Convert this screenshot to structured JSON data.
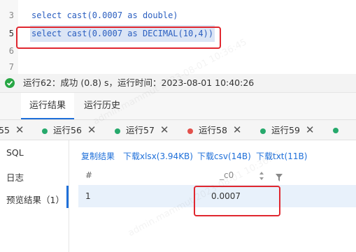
{
  "editor": {
    "lines": [
      {
        "num": "3",
        "code": "select cast(0.0007 as double)"
      },
      {
        "num": "5",
        "code": "select cast(0.0007 as DECIMAL(10,4))"
      },
      {
        "num": "6",
        "code": ""
      },
      {
        "num": "7",
        "code": ""
      }
    ]
  },
  "status": {
    "text": "运行62：成功 (0.8) s，运行时间：2023-08-01 10:40:26",
    "color": "#28a745"
  },
  "result_tabs": [
    "运行结果",
    "运行历史"
  ],
  "run_tabs": [
    {
      "label": "55",
      "status": "partial"
    },
    {
      "label": "运行56",
      "color": "#26a96c"
    },
    {
      "label": "运行57",
      "color": "#26a96c"
    },
    {
      "label": "运行58",
      "color": "#e2514c"
    },
    {
      "label": "运行59",
      "color": "#26a96c"
    },
    {
      "label": "",
      "color": "#26a96c"
    }
  ],
  "sidebar": {
    "items": [
      "SQL",
      "日志",
      "预览结果（1）"
    ]
  },
  "actions": [
    "复制结果",
    "下载xlsx(3.94KB)",
    "下载csv(14B)",
    "下载txt(11B)"
  ],
  "grid": {
    "header_num": "#",
    "column": "_c0",
    "rows": [
      {
        "num": "1",
        "value": "0.0007"
      }
    ]
  },
  "watermark": "admin.mammut 2023-08-01 10:36:45"
}
